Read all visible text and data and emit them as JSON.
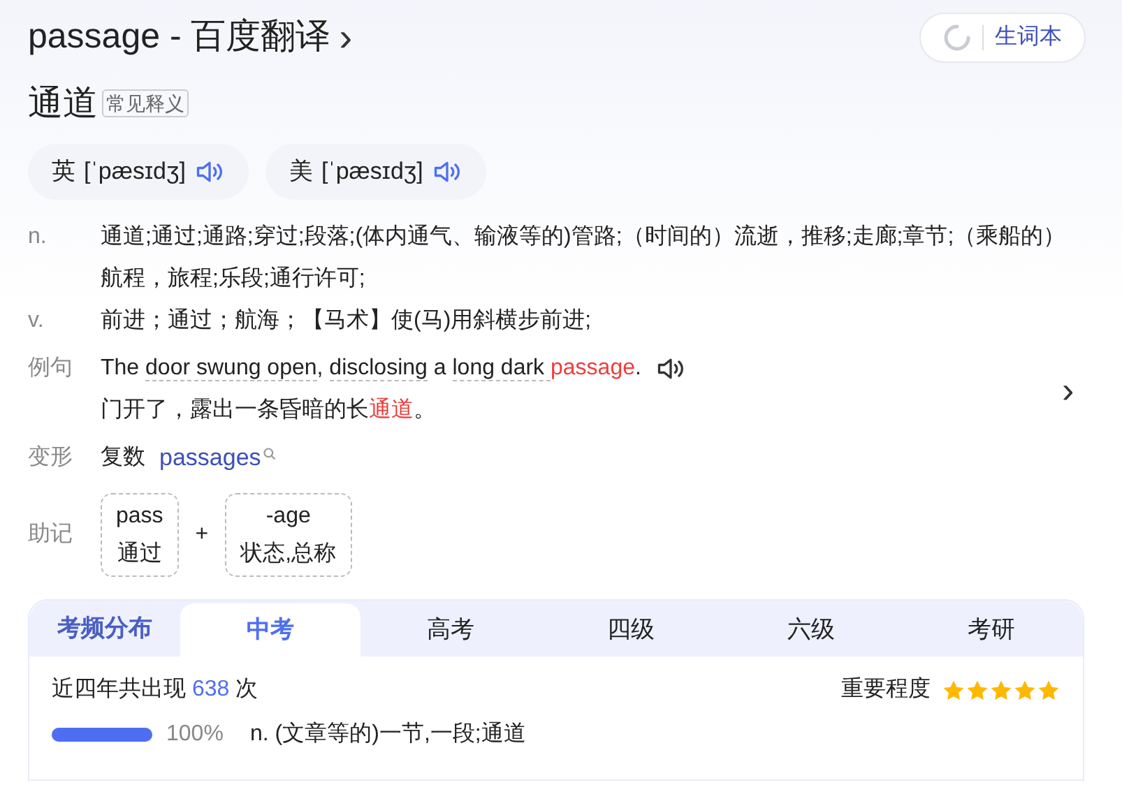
{
  "header": {
    "title": "passage - 百度翻译",
    "chevron": "›",
    "wordbook_button": "生词本"
  },
  "headword": {
    "meaning": "通道",
    "tag": "常见释义"
  },
  "pronunciations": [
    {
      "label": "英",
      "ipa": "[ˈpæsɪdʒ]"
    },
    {
      "label": "美",
      "ipa": "[ˈpæsɪdʒ]"
    }
  ],
  "definitions": [
    {
      "pos": "n.",
      "text": "通道;通过;通路;穿过;段落;(体内通气、输液等的)管路;（时间的）流逝，推移;走廊;章节;（乘船的）航程，旅程;乐段;通行许可;"
    },
    {
      "pos": "v.",
      "text": "前进；通过；航海；【马术】使(马)用斜横步前进;"
    }
  ],
  "example": {
    "label": "例句",
    "english": [
      {
        "kind": "plain",
        "text": "The "
      },
      {
        "kind": "underlined",
        "text": "door swung open"
      },
      {
        "kind": "plain",
        "text": ", "
      },
      {
        "kind": "underlined",
        "text": "disclosing"
      },
      {
        "kind": "plain",
        "text": " a "
      },
      {
        "kind": "underlined",
        "text": "long dark "
      },
      {
        "kind": "highlight",
        "text": "passage"
      },
      {
        "kind": "plain",
        "text": "."
      }
    ],
    "chinese": [
      {
        "kind": "plain",
        "text": "门开了，露出一条昏暗的长"
      },
      {
        "kind": "highlight",
        "text": "通道"
      },
      {
        "kind": "plain",
        "text": "。"
      }
    ],
    "chevron": "›"
  },
  "inflection": {
    "label": "变形",
    "type": "复数",
    "word": "passages"
  },
  "mnemonic": {
    "label": "助记",
    "parts": [
      {
        "root": "pass",
        "meaning": "通过"
      },
      {
        "root": "-age",
        "meaning": "状态,总称"
      }
    ],
    "joiner": "+"
  },
  "frequency": {
    "heading": "考频分布",
    "tabs": [
      {
        "label": "中考",
        "selected": true
      },
      {
        "label": "高考",
        "selected": false
      },
      {
        "label": "四级",
        "selected": false
      },
      {
        "label": "六级",
        "selected": false
      },
      {
        "label": "考研",
        "selected": false
      }
    ],
    "count_prefix": "近四年共出现",
    "count": "638",
    "count_suffix": "次",
    "importance_label": "重要程度",
    "stars": 5,
    "senses": [
      {
        "level": 1,
        "percent": "100%",
        "text": "n. (文章等的)一节,一段;通道"
      }
    ]
  }
}
